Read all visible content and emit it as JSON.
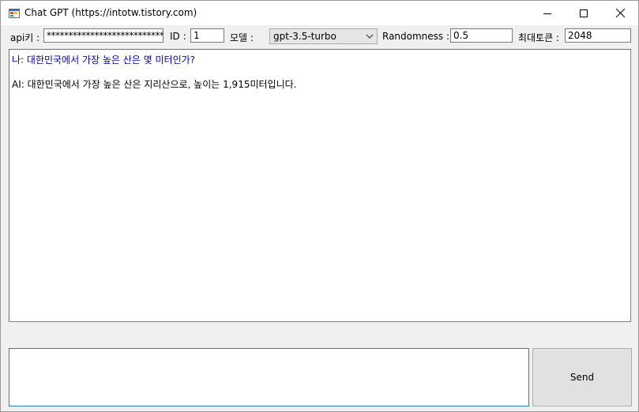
{
  "window": {
    "title": "Chat GPT (https://intotw.tistory.com)",
    "controls": [
      "minimize-icon",
      "maximize-icon",
      "close-icon"
    ]
  },
  "toolbar": {
    "api_key_label": "api키 :",
    "api_key_value": "************************************",
    "id_label": "ID :",
    "id_value": "1",
    "model_label": "모델 :",
    "model_value": "gpt-3.5-turbo",
    "randomness_label": "Randomness :",
    "randomness_value": "0.5",
    "max_tokens_label": "최대토큰 :",
    "max_tokens_value": "2048"
  },
  "chat": {
    "messages": [
      {
        "role": "user",
        "text": "나: 대한민국에서 가장 높은 산은 몇 미터인가?"
      },
      {
        "role": "ai",
        "text": "AI: 대한민국에서 가장 높은 산은 지리산으로, 높이는 1,915미터입니다."
      }
    ],
    "user_color": "#0000c8"
  },
  "composer": {
    "input_value": "",
    "send_label": "Send"
  }
}
